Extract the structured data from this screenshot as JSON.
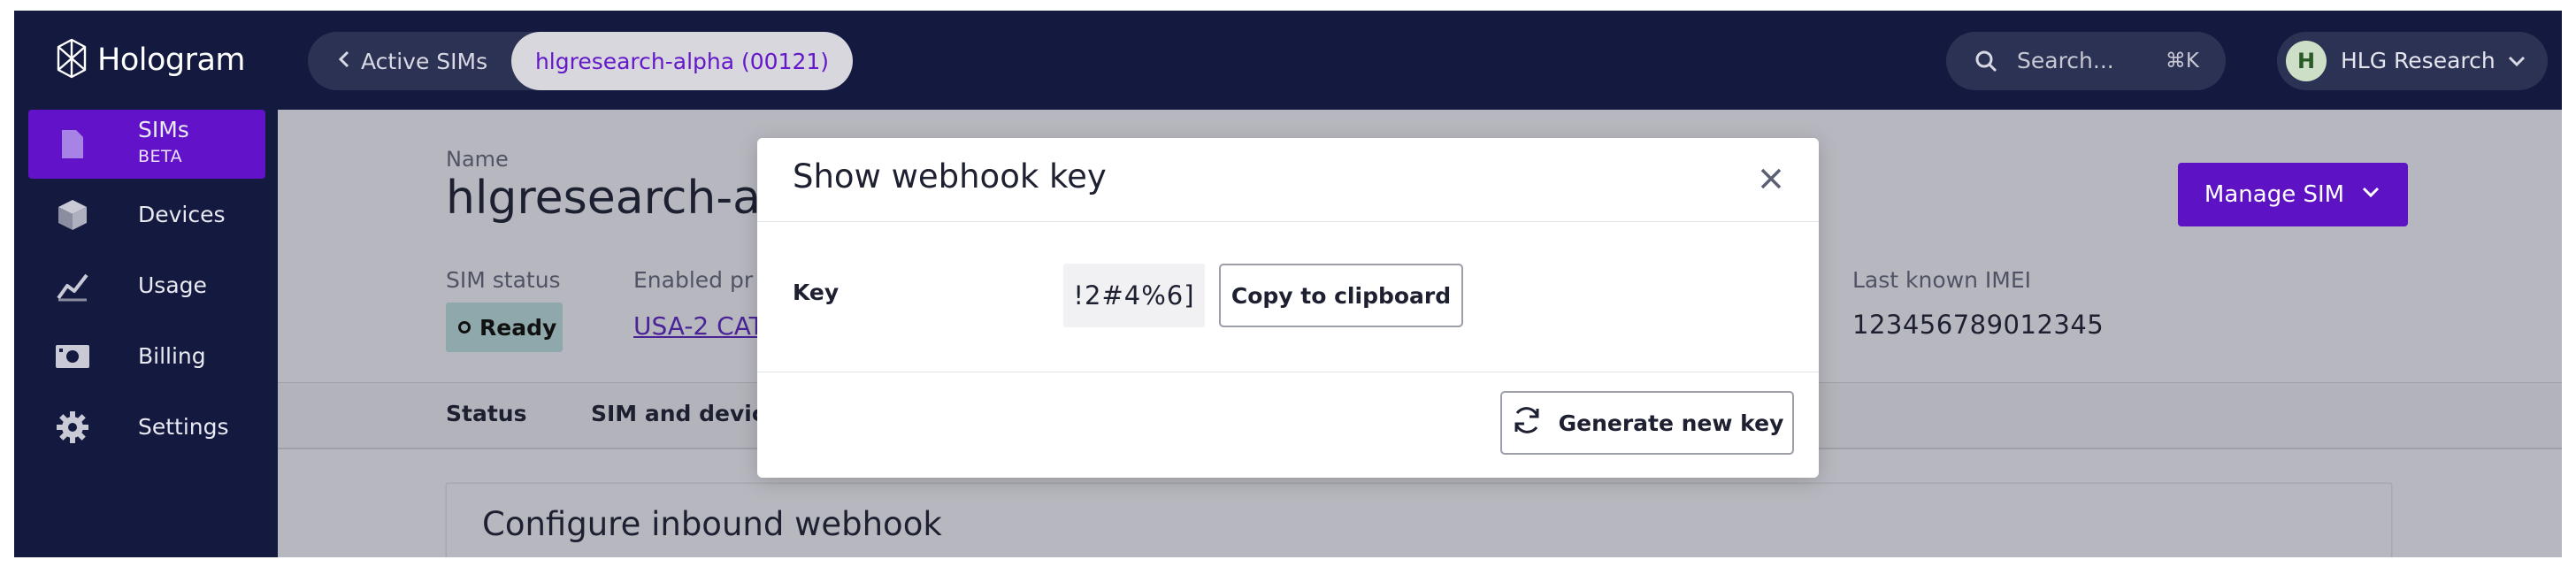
{
  "sidebar": {
    "logo_text": "Hologram",
    "items": [
      {
        "label": "SIMs",
        "badge": "BETA",
        "icon": "sim-card-icon",
        "active": true
      },
      {
        "label": "Devices",
        "icon": "cube-icon"
      },
      {
        "label": "Usage",
        "icon": "chart-line-icon"
      },
      {
        "label": "Billing",
        "icon": "banknote-icon"
      },
      {
        "label": "Settings",
        "icon": "gear-icon"
      }
    ]
  },
  "topbar": {
    "back_label": "Active SIMs",
    "current_crumb": "hlgresearch-alpha (00121)",
    "search_placeholder": "Search...",
    "search_shortcut": "⌘K",
    "account_initial": "H",
    "account_name": "HLG Research"
  },
  "page": {
    "name_label": "Name",
    "sim_name": "hlgresearch-alpha",
    "manage_button": "Manage SIM",
    "sim_status_label": "SIM status",
    "sim_status_value": "Ready",
    "enabled_label": "Enabled pr",
    "plan_link": "USA-2 CAT",
    "imei_label": "Last known IMEI",
    "imei_value": "123456789012345",
    "tabs": [
      "Status",
      "SIM and device"
    ],
    "card_title": "Configure inbound webhook"
  },
  "modal": {
    "title": "Show webhook key",
    "key_label": "Key",
    "key_value": "!2#4%6]",
    "copy_button": "Copy to clipboard",
    "generate_button": "Generate new key"
  },
  "colors": {
    "sidebar_bg": "#141a3f",
    "accent_purple": "#6212c8",
    "overlay_gray": "#b7b8bf"
  }
}
